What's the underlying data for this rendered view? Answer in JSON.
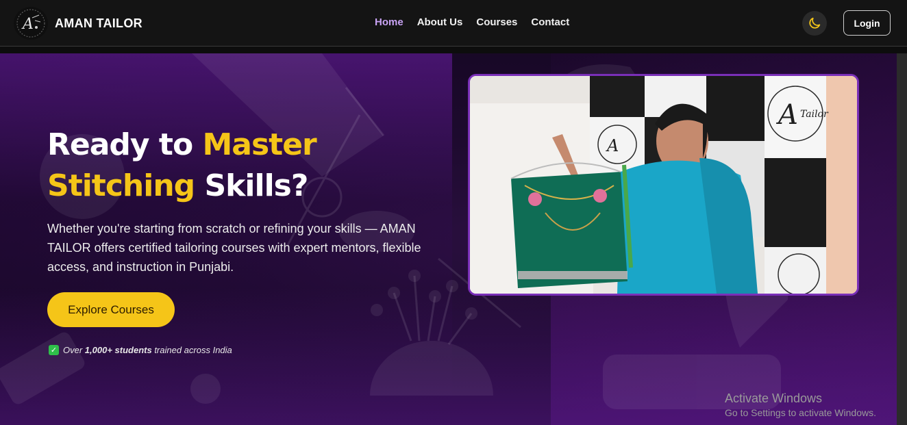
{
  "brand": {
    "name": "AMAN TAILOR",
    "logo_icon": "sewing-logo-icon"
  },
  "nav": {
    "links": [
      {
        "label": "Home",
        "active": true
      },
      {
        "label": "About Us",
        "active": false
      },
      {
        "label": "Courses",
        "active": false
      },
      {
        "label": "Contact",
        "active": false
      }
    ],
    "theme_icon": "moon-icon",
    "login_label": "Login"
  },
  "hero": {
    "title_part1": "Ready to ",
    "title_highlight": "Master Stitching",
    "title_part2": " Skills?",
    "description": "Whether you're starting from scratch or refining your skills — AMAN TAILOR offers certified tailoring courses with expert mentors, flexible access, and instruction in Punjabi.",
    "cta_label": "Explore Courses",
    "stat_prefix": "Over ",
    "stat_bold": "1,000+ students",
    "stat_suffix": " trained across India",
    "photo_logo_text": "Tailor"
  },
  "os_watermark": {
    "title": "Activate Windows",
    "subtitle": "Go to Settings to activate Windows."
  },
  "colors": {
    "accent_yellow": "#f5c518",
    "nav_active": "#c9a3f5",
    "photo_border": "#7a2fb8",
    "hero_purple": "#1d0a2e"
  }
}
